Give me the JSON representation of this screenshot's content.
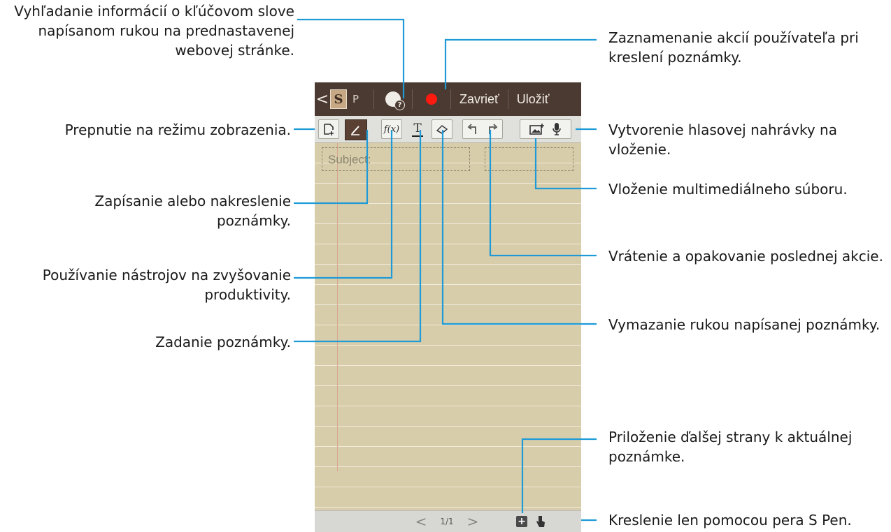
{
  "phone": {
    "actionbar": {
      "back": "<",
      "logo": "S",
      "title": "P",
      "close_label": "Zavrieť",
      "save_label": "Uložiť"
    },
    "paper": {
      "subject_placeholder": "Subject:"
    },
    "bottombar": {
      "prev": "<",
      "page": "1/1",
      "next": ">"
    }
  },
  "callouts": {
    "search_keyword": "Vyhľadanie informácií o kľúčovom slove napísanom rukou na prednastavenej webovej stránke.",
    "view_mode": "Prepnutie na režimu zobrazenia.",
    "write_draw": "Zapísanie alebo nakreslenie poznámky.",
    "productivity": "Používanie nástrojov na zvyšovanie produktivity.",
    "type_memo": "Zadanie poznámky.",
    "record_actions": "Zaznamenanie akcií používateľa pri kreslení poznámky.",
    "voice_memo": "Vytvorenie hlasovej nahrávky na vloženie.",
    "insert_media": "Vloženie multimediálneho súboru.",
    "undo_redo": "Vrátenie a opakovanie poslednej akcie.",
    "erase": "Vymazanie rukou napísanej poznámky.",
    "add_page": "Priloženie ďalšej strany k aktuálnej poznámke.",
    "pen_only": "Kreslenie len pomocou pera S Pen."
  },
  "colors": {
    "accent": "#1e9bd7",
    "actionbar": "#4a3a32",
    "paper": "#d8cdaa"
  }
}
